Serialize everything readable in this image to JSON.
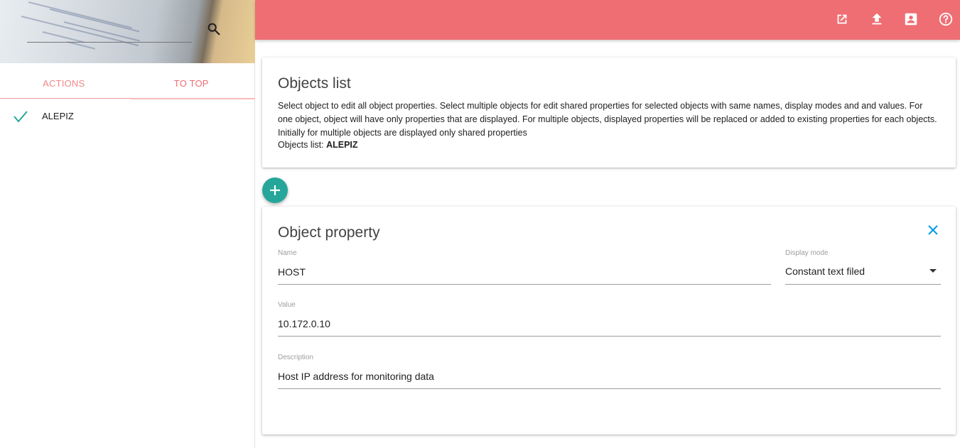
{
  "sidebar": {
    "search": {
      "placeholder": "",
      "value": ""
    },
    "tabs": [
      {
        "label": "ACTIONS"
      },
      {
        "label": "TO TOP"
      }
    ],
    "objects": [
      {
        "label": "ALEPIZ",
        "checked": true
      }
    ]
  },
  "topnav": {
    "icons": [
      "open-in-new-icon",
      "upload-icon",
      "account-box-icon",
      "help-icon"
    ]
  },
  "objects_card": {
    "title": "Objects list",
    "description": "Select object to edit all object properties. Select multiple objects for edit shared properties for selected objects with same names, display modes and and values. For one object, object will have only properties that are displayed. For multiple objects, displayed properties will be replaced or added to existing properties for each objects. Initially for multiple objects are displayed only shared properties",
    "list_label": "Objects list: ",
    "list_value": "ALEPIZ"
  },
  "property_card": {
    "title": "Object property",
    "name_label": "Name",
    "name_value": "HOST",
    "display_mode_label": "Display mode",
    "display_mode_value": "Constant text filed",
    "value_label": "Value",
    "value_value": "10.172.0.10",
    "description_label": "Description",
    "description_value": "Host IP address for monitoring data"
  },
  "colors": {
    "nav": "#ef6e73",
    "accent": "#26a69a",
    "tab_text": "#ee6e73",
    "close": "#039be5"
  }
}
